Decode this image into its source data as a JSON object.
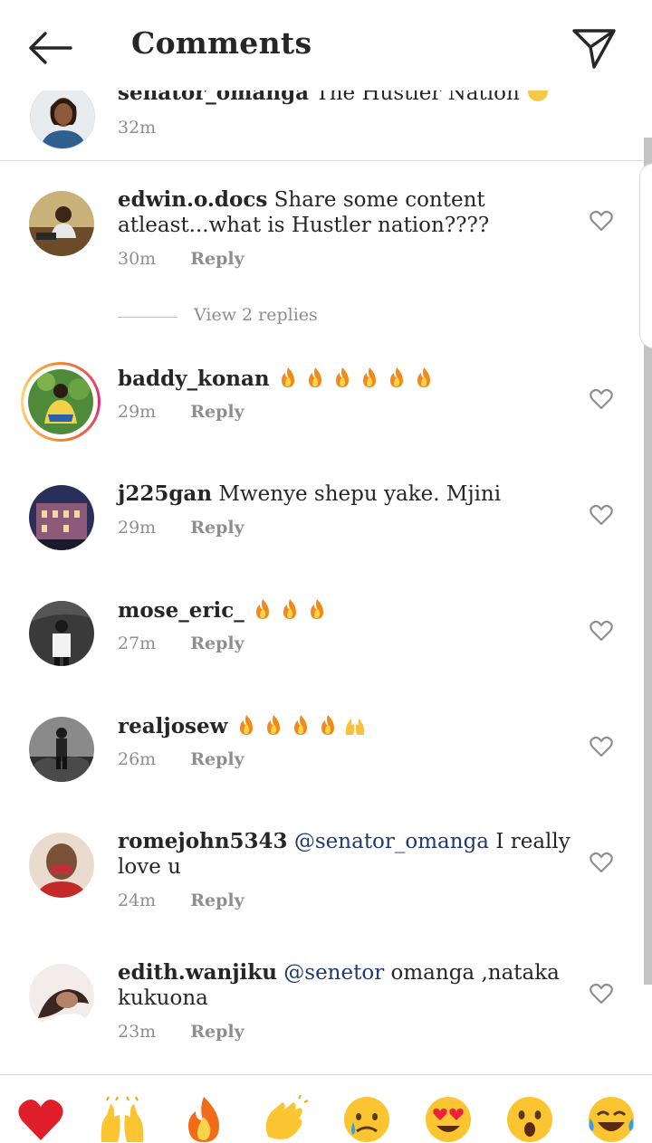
{
  "header": {
    "title": "Comments"
  },
  "caption": {
    "username": "senator_omanga",
    "text": "The Hustler Nation",
    "time": "32m"
  },
  "comments": [
    {
      "username": "edwin.o.docs",
      "text": "Share some content atleast...what is Hustler nation????",
      "time": "30m",
      "reply_label": "Reply"
    },
    {
      "username": "baddy_konan",
      "text": "",
      "time": "29m",
      "reply_label": "Reply",
      "emojis": [
        "fire",
        "fire",
        "fire",
        "fire",
        "fire",
        "fire"
      ]
    },
    {
      "username": "j225gan",
      "text": "Mwenye shepu yake. Mjini",
      "time": "29m",
      "reply_label": "Reply"
    },
    {
      "username": "mose_eric_",
      "text": "",
      "time": "27m",
      "reply_label": "Reply",
      "emojis": [
        "fire",
        "fire",
        "fire"
      ]
    },
    {
      "username": "realjosew",
      "text": "",
      "time": "26m",
      "reply_label": "Reply",
      "emojis": [
        "fire",
        "fire",
        "fire",
        "fire",
        "raised-hands"
      ]
    },
    {
      "username": "romejohn5343",
      "mention": "@senator_omanga",
      "text": "I really love u",
      "time": "24m",
      "reply_label": "Reply"
    },
    {
      "username": "edith.wanjiku",
      "mention": "@senetor",
      "text": "omanga ,nataka kukuona",
      "time": "23m",
      "reply_label": "Reply"
    }
  ],
  "view_replies": "View 2 replies",
  "emoji_bar": [
    "red-heart",
    "raised-hands",
    "fire",
    "clapping-hands",
    "crying-face",
    "heart-eyes",
    "open-mouth",
    "tears-of-joy"
  ],
  "colors": {
    "text": "#262626",
    "secondary": "#8e8e8e",
    "mention": "#1e3a6e",
    "divider": "#dbdbdb",
    "story_ring": "#dd2a7b"
  }
}
